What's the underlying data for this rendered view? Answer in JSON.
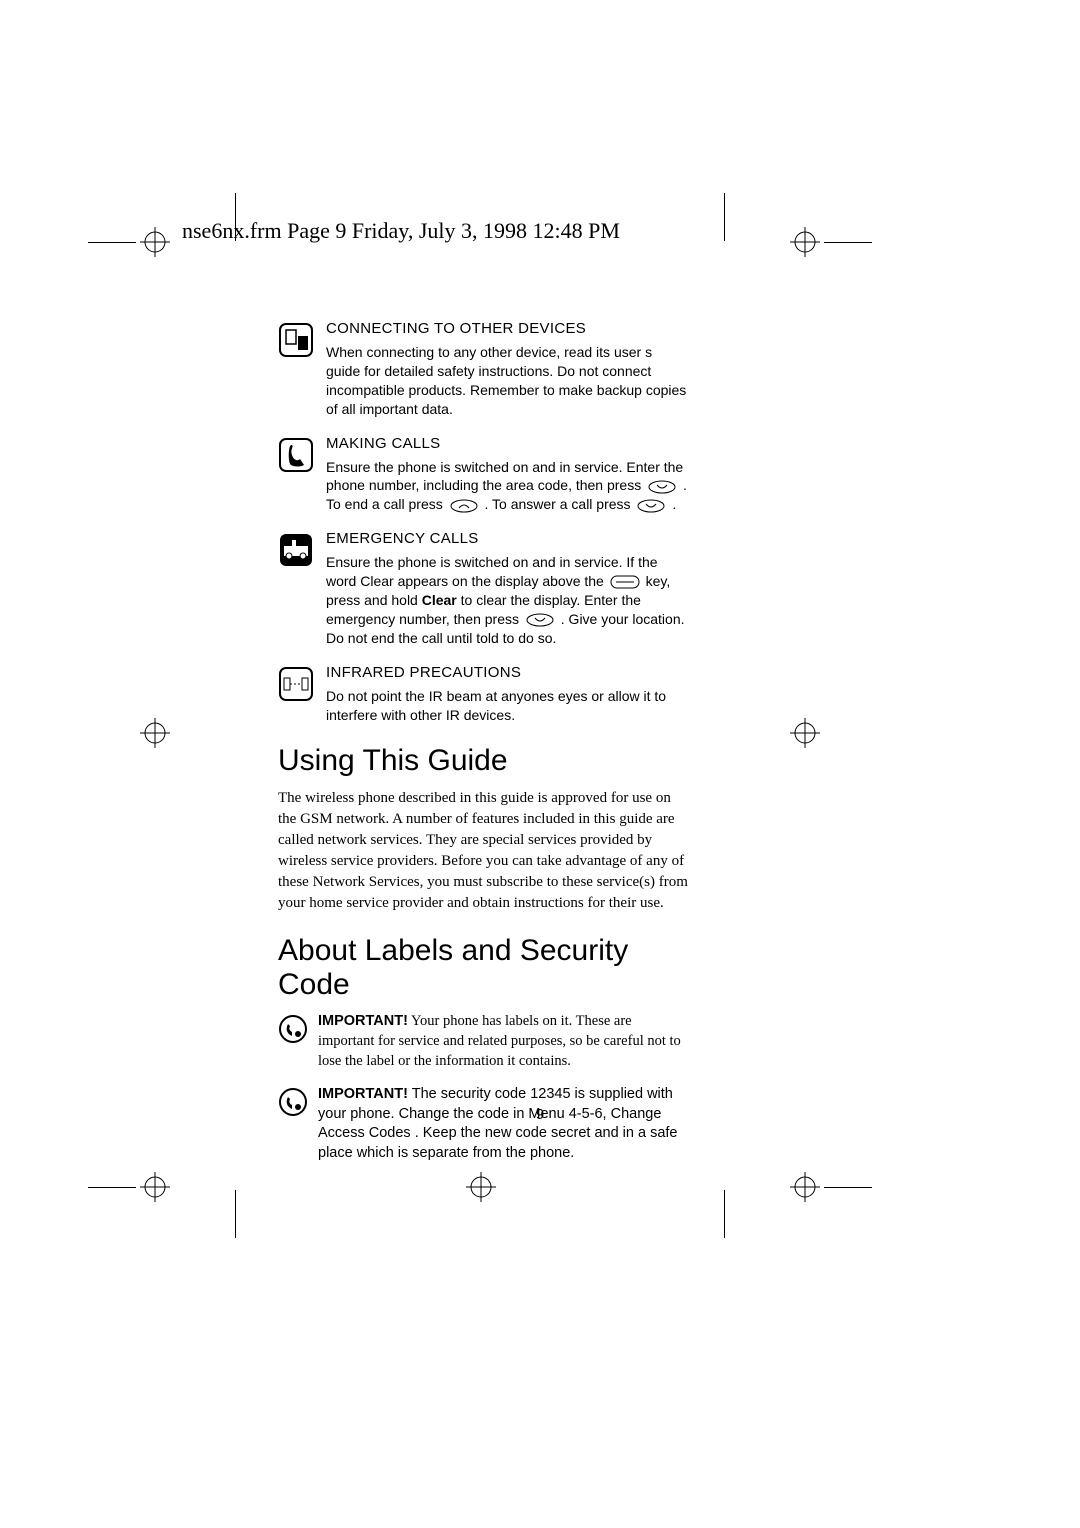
{
  "header": "nse6nx.frm  Page 9  Friday, July 3, 1998  12:48 PM",
  "sections": [
    {
      "title": "CONNECTING TO OTHER DEVICES",
      "text": "When connecting to any other device, read its user s guide for detailed safety instructions. Do not connect incompatible products. Remember to make backup copies of all important data."
    },
    {
      "title": "MAKING CALLS",
      "text_1": "Ensure the phone is switched on and in service. Enter the phone number, including the area code, then press ",
      "text_2": " . To end a call press ",
      "text_3": " . To answer a call press ",
      "text_4": " ."
    },
    {
      "title": "EMERGENCY CALLS",
      "text_1": "Ensure the phone is switched on and in service. If the word  Clear  appears on the display above the ",
      "text_2": " key, press and hold ",
      "clear_word": "Clear",
      "text_3": " to clear the display. Enter the emergency number, then press ",
      "text_4": " . Give your location. Do not end the call until told to do so."
    },
    {
      "title": "INFRARED PRECAUTIONS",
      "text": "Do not point the IR beam at anyones eyes or allow it to interfere with other IR devices."
    }
  ],
  "h1": "Using This Guide",
  "p1": "The wireless phone described in this guide is approved for use on the GSM network. A number of features included in this guide are called network services. They are special services provided by wireless service providers. Before you can take advantage of any of these Network Services, you must subscribe to these service(s) from your home service provider and obtain instructions for their use.",
  "h2": "About Labels and Security Code",
  "important_word": "IMPORTANT!",
  "imp1": " Your phone has labels on it. These are important for service and related purposes, so be careful not to lose the label or the information it contains.",
  "imp2a": " The security code 12345 is supplied with your phone. Change the code in Menu 4-5-6,  Change Access Codes . Keep the new code secret and in a safe place which is separate from the phone.",
  "page_number": "9"
}
